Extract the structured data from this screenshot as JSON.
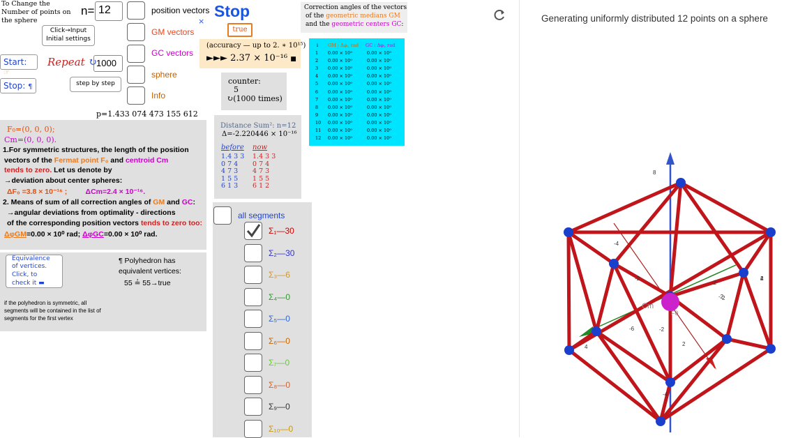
{
  "controls": {
    "change_number_label": "To Change the Number of points on the sphere",
    "n_label": "n=",
    "n_value": "12",
    "input_button": "Click→Input Initial settings",
    "start_label": "Start:",
    "repeat_label": "Repeat",
    "repeat_value": "1000",
    "stop_label": "Stop:",
    "step_button": "step by step"
  },
  "toggles": [
    {
      "label": "position vectors",
      "color": "#000000"
    },
    {
      "label": "GM vectors",
      "color": "#e8461e"
    },
    {
      "label": "GC vectors",
      "color": "#cc00cc"
    },
    {
      "label": "sphere",
      "color": "#c06000"
    },
    {
      "label": "Info",
      "color": "#c06000"
    }
  ],
  "stop": {
    "title": "Stop",
    "close": "×",
    "value": "true"
  },
  "accuracy": {
    "line1": "(accuracy — up to  2. ∗ 10¹⁵)",
    "line2": "►►►  2.37 × 10⁻¹⁶"
  },
  "counter": {
    "label": "counter:",
    "value": "5",
    "times": "↻(1000 times)"
  },
  "distance": {
    "line1": "Distance Sum²: n=12",
    "line2": "Δ=-2.220446 × 10⁻¹⁶"
  },
  "before_now": {
    "before_label": "before",
    "now_label": "now",
    "before_rows": [
      "1.4 3 3",
      "0 7 4",
      "4 7 3",
      "1 5 5",
      "6 1 3"
    ],
    "now_rows": [
      "1.4 3 3",
      "0 7 4",
      "4 7 3",
      "1 5 5",
      "6 1 2"
    ]
  },
  "p_value": "p=1.433 074 473 155 612",
  "info": {
    "fo": "F₀=(0, 0, 0);",
    "cm": "Cm=(0, 0, 0).",
    "l1": "1.For symmetric structures, the length of the position",
    "l2a": "vectors of the ",
    "l2b": "Fermat point  F₀",
    "l2c": " and ",
    "l2d": "centroid Cm",
    "l3a": "tends to zero.",
    "l3b": " Let us denote by",
    "l4": "→deviation about center spheres:",
    "l5a": "ΔF₀ =3.8 × 10⁻¹⁶ ;",
    "l5b": "ΔCm=2.4 × 10⁻¹⁶.",
    "l6a": "2. Means of sum of all correction angles of ",
    "l6b": "GM",
    "l6c": " and ",
    "l6d": "GC",
    "l6e": ":",
    "l7": "→angular deviations from optimality - directions",
    "l8a": "of the corresponding position vectors ",
    "l8b": "tends to zero too:",
    "l9a": "ΔφGM",
    "l9b": "=0.00 × 10⁰  rad;  ",
    "l9c": "ΔφGC",
    "l9d": "=0.00 × 10⁰  rad."
  },
  "equivalence": {
    "button": "Equivalence of vertices. Click, to check it ▬",
    "poly1": "¶ Polyhedron has",
    "poly2": "equivalent vertices:",
    "poly3": "55 ≟ 55→true",
    "note": "if the polyhedron is symmetric, all segments will be contained in the list of segments for the first vertex"
  },
  "correction": {
    "title1": "Correction angles of the vectors",
    "title2a": "of the  ",
    "title2b": "geometric medians GM",
    "title3a": "and the ",
    "title3b": "geometric centers  GC",
    "title3c": ":",
    "header_i": "i",
    "header_gm": "GM : Δφᵢ, rad",
    "header_gc": "GC : Δφᵢ, rad",
    "rows": [
      {
        "i": "1",
        "gm": "0.00 × 10⁰",
        "gc": "0.00 × 10⁰"
      },
      {
        "i": "2",
        "gm": "0.00 × 10⁰",
        "gc": "0.00 × 10⁰"
      },
      {
        "i": "3",
        "gm": "0.00 × 10⁰",
        "gc": "0.00 × 10⁰"
      },
      {
        "i": "4",
        "gm": "0.00 × 10⁰",
        "gc": "0.00 × 10⁰"
      },
      {
        "i": "5",
        "gm": "0.00 × 10⁰",
        "gc": "0.00 × 10⁰"
      },
      {
        "i": "6",
        "gm": "0.00 × 10⁰",
        "gc": "0.00 × 10⁰"
      },
      {
        "i": "7",
        "gm": "0.00 × 10⁰",
        "gc": "0.00 × 10⁰"
      },
      {
        "i": "8",
        "gm": "0.00 × 10⁰",
        "gc": "0.00 × 10⁰"
      },
      {
        "i": "9",
        "gm": "0.00 × 10⁰",
        "gc": "0.00 × 10⁰"
      },
      {
        "i": "10",
        "gm": "0.00 × 10⁰",
        "gc": "0.00 × 10⁰"
      },
      {
        "i": "11",
        "gm": "0.00 × 10⁰",
        "gc": "0.00 × 10⁰"
      },
      {
        "i": "12",
        "gm": "0.00 × 10⁰",
        "gc": "0.00 × 10⁰"
      }
    ]
  },
  "segments": {
    "all_label": "all segments",
    "items": [
      {
        "label": "Σ₁—30",
        "color": "#cc0000",
        "checked": true
      },
      {
        "label": "Σ₂—30",
        "color": "#3333cc",
        "checked": false
      },
      {
        "label": "Σ₃—6",
        "color": "#cc9933",
        "checked": false
      },
      {
        "label": "Σ₄—0",
        "color": "#339933",
        "checked": false
      },
      {
        "label": "Σ₅—0",
        "color": "#3366cc",
        "checked": false
      },
      {
        "label": "Σ₆—0",
        "color": "#cc6600",
        "checked": false
      },
      {
        "label": "Σ₇—0",
        "color": "#66cc33",
        "checked": false
      },
      {
        "label": "Σ₈—0",
        "color": "#cc6633",
        "checked": false
      },
      {
        "label": "Σ₉—0",
        "color": "#333333",
        "checked": false
      },
      {
        "label": "Σ₁₀—0",
        "color": "#cc9900",
        "checked": false
      }
    ]
  },
  "view3d": {
    "title": "Generating uniformly distributed  12 points on a sphere",
    "refresh_icon": "refresh-icon",
    "cm_label": "Cm",
    "fo_label": "F0",
    "axis_labels": [
      "8",
      "-4",
      "-2",
      "2",
      "4",
      "-2",
      "-4",
      "-6",
      "-2",
      "2",
      "4",
      "-2",
      "2",
      "4"
    ]
  }
}
